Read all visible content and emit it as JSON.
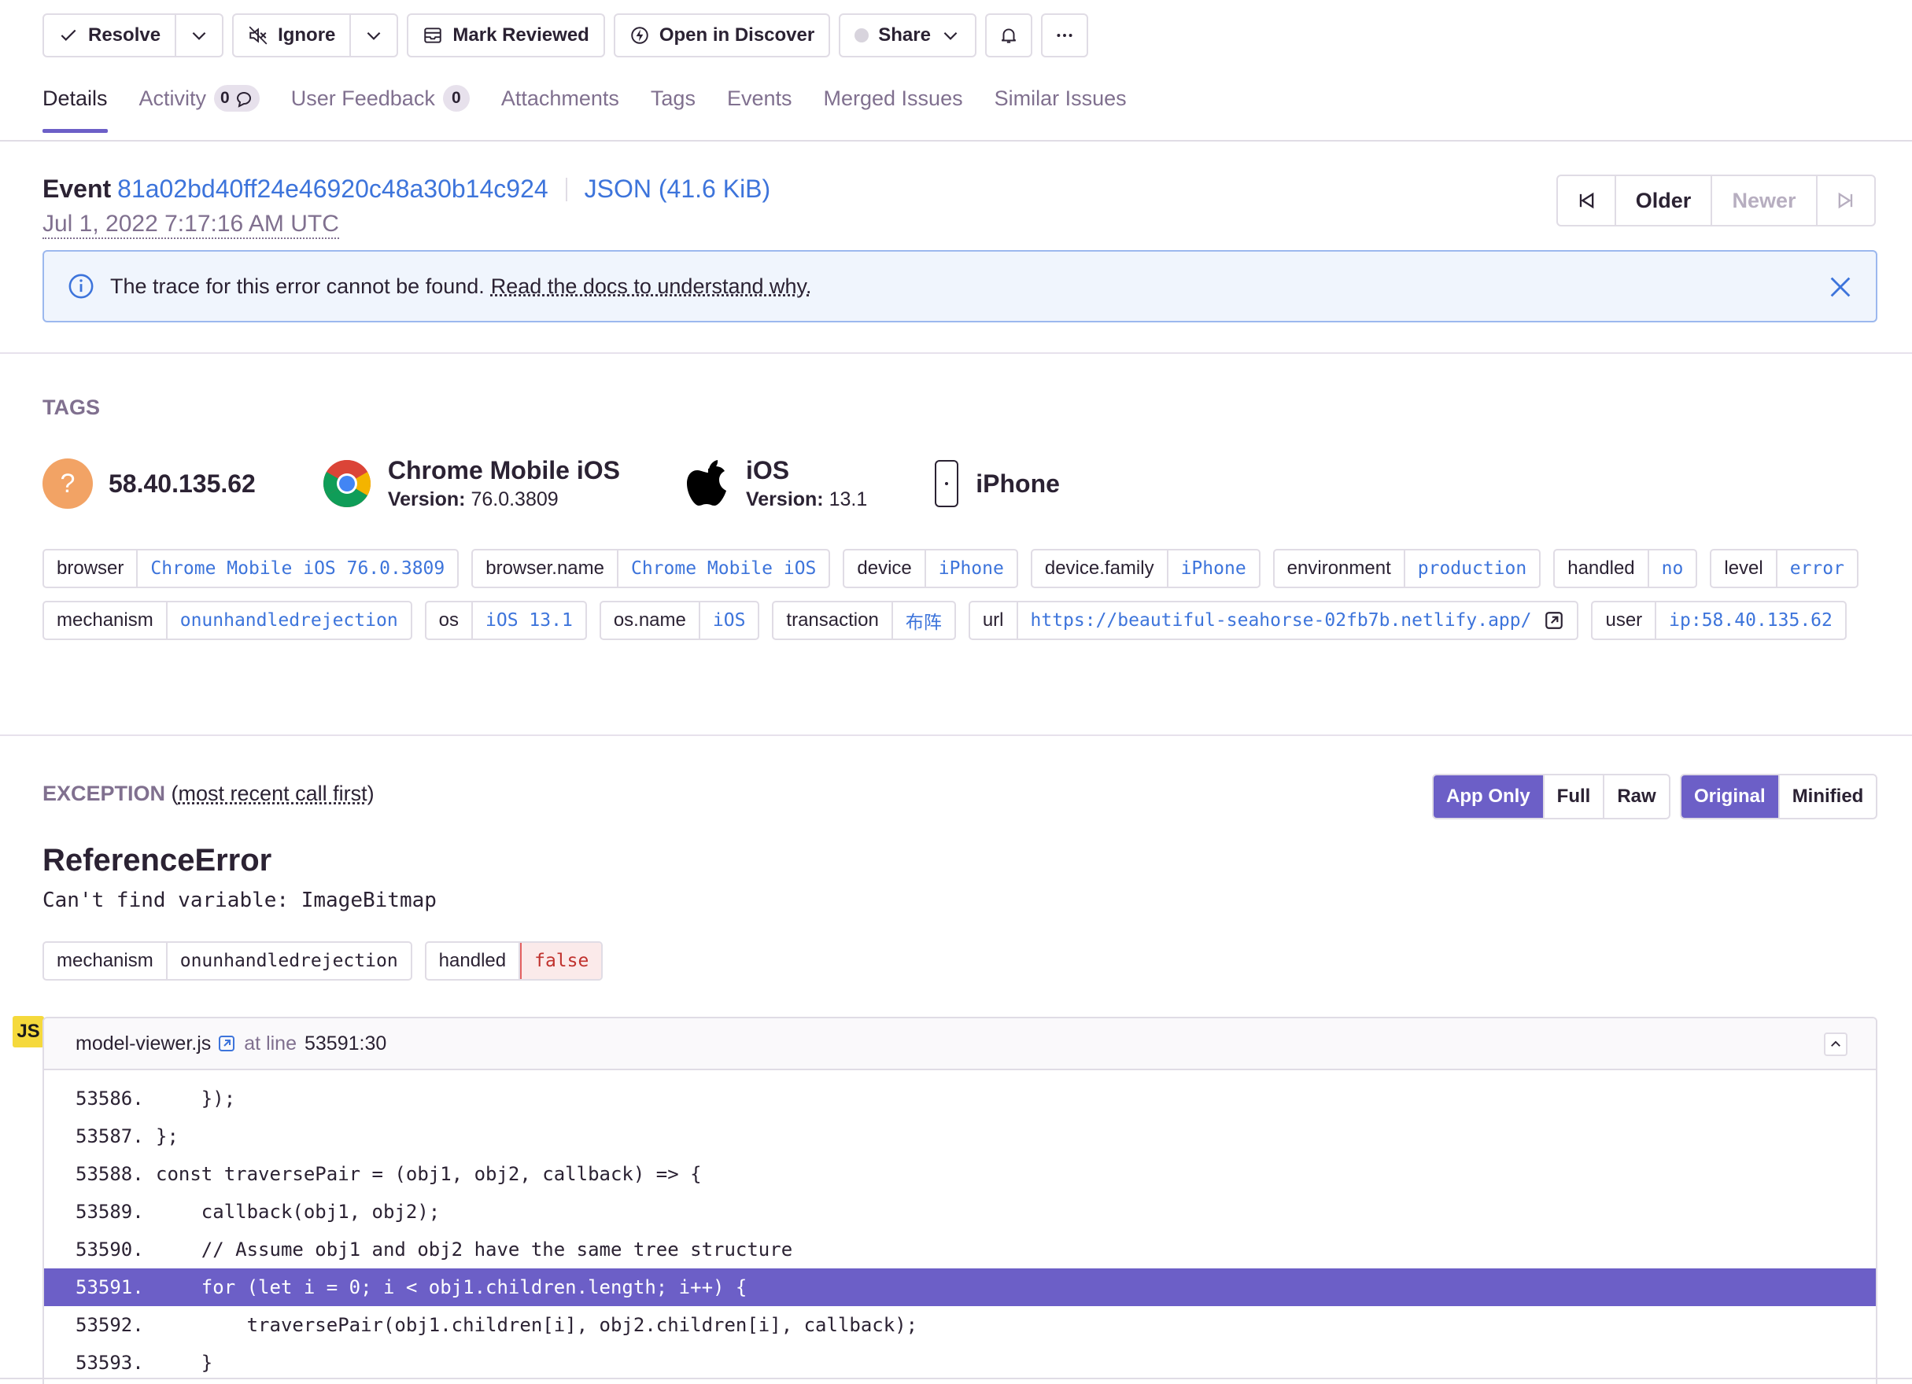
{
  "toolbar": {
    "resolve": "Resolve",
    "ignore": "Ignore",
    "mark_reviewed": "Mark Reviewed",
    "open_in_discover": "Open in Discover",
    "share": "Share"
  },
  "tabs": {
    "details": "Details",
    "activity": "Activity",
    "activity_count": "0",
    "user_feedback": "User Feedback",
    "user_feedback_count": "0",
    "attachments": "Attachments",
    "tags": "Tags",
    "events": "Events",
    "merged_issues": "Merged Issues",
    "similar_issues": "Similar Issues"
  },
  "event": {
    "label": "Event",
    "id": "81a02bd40ff24e46920c48a30b14c924",
    "json_link": "JSON (41.6 KiB)",
    "date": "Jul 1, 2022 7:17:16 AM UTC"
  },
  "pager": {
    "older": "Older",
    "newer": "Newer"
  },
  "alert": {
    "text": "The trace for this error cannot be found.",
    "link": "Read the docs to understand why."
  },
  "tags_section": {
    "title": "TAGS",
    "summary": {
      "ip": "58.40.135.62",
      "browser_name": "Chrome Mobile iOS",
      "browser_version_label": "Version:",
      "browser_version": "76.0.3809",
      "os_name": "iOS",
      "os_version_label": "Version:",
      "os_version": "13.1",
      "device": "iPhone"
    },
    "tags": [
      {
        "key": "browser",
        "value": "Chrome Mobile iOS 76.0.3809"
      },
      {
        "key": "browser.name",
        "value": "Chrome Mobile iOS"
      },
      {
        "key": "device",
        "value": "iPhone"
      },
      {
        "key": "device.family",
        "value": "iPhone"
      },
      {
        "key": "environment",
        "value": "production"
      },
      {
        "key": "handled",
        "value": "no"
      },
      {
        "key": "level",
        "value": "error"
      },
      {
        "key": "mechanism",
        "value": "onunhandledrejection"
      },
      {
        "key": "os",
        "value": "iOS 13.1"
      },
      {
        "key": "os.name",
        "value": "iOS"
      },
      {
        "key": "transaction",
        "value": "布阵"
      },
      {
        "key": "url",
        "value": "https://beautiful-seahorse-02fb7b.netlify.app/"
      },
      {
        "key": "user",
        "value": "ip:58.40.135.62"
      }
    ]
  },
  "exception": {
    "title": "EXCEPTION",
    "order": "most recent call first",
    "view_app_only": "App Only",
    "view_full": "Full",
    "view_raw": "Raw",
    "view_original": "Original",
    "view_minified": "Minified",
    "type": "ReferenceError",
    "value": "Can't find variable: ImageBitmap",
    "mech_key": "mechanism",
    "mech_value": "onunhandledrejection",
    "handled_key": "handled",
    "handled_value": "false",
    "platform_badge": "JS",
    "frame_file": "model-viewer.js",
    "frame_at": "at line",
    "frame_line": "53591:30",
    "code": [
      {
        "ln": "53586.",
        "text": "    });"
      },
      {
        "ln": "53587.",
        "text": "};"
      },
      {
        "ln": "53588.",
        "text": "const traversePair = (obj1, obj2, callback) => {"
      },
      {
        "ln": "53589.",
        "text": "    callback(obj1, obj2);"
      },
      {
        "ln": "53590.",
        "text": "    // Assume obj1 and obj2 have the same tree structure"
      },
      {
        "ln": "53591.",
        "text": "    for (let i = 0; i < obj1.children.length; i++) {"
      },
      {
        "ln": "53592.",
        "text": "        traversePair(obj1.children[i], obj2.children[i], callback);"
      },
      {
        "ln": "53593.",
        "text": "    }"
      }
    ],
    "active_line": "53591."
  },
  "colors": {
    "accent": "#6c5fc7",
    "link": "#3d74db",
    "muted": "#80708f",
    "border": "#e0dce5"
  }
}
